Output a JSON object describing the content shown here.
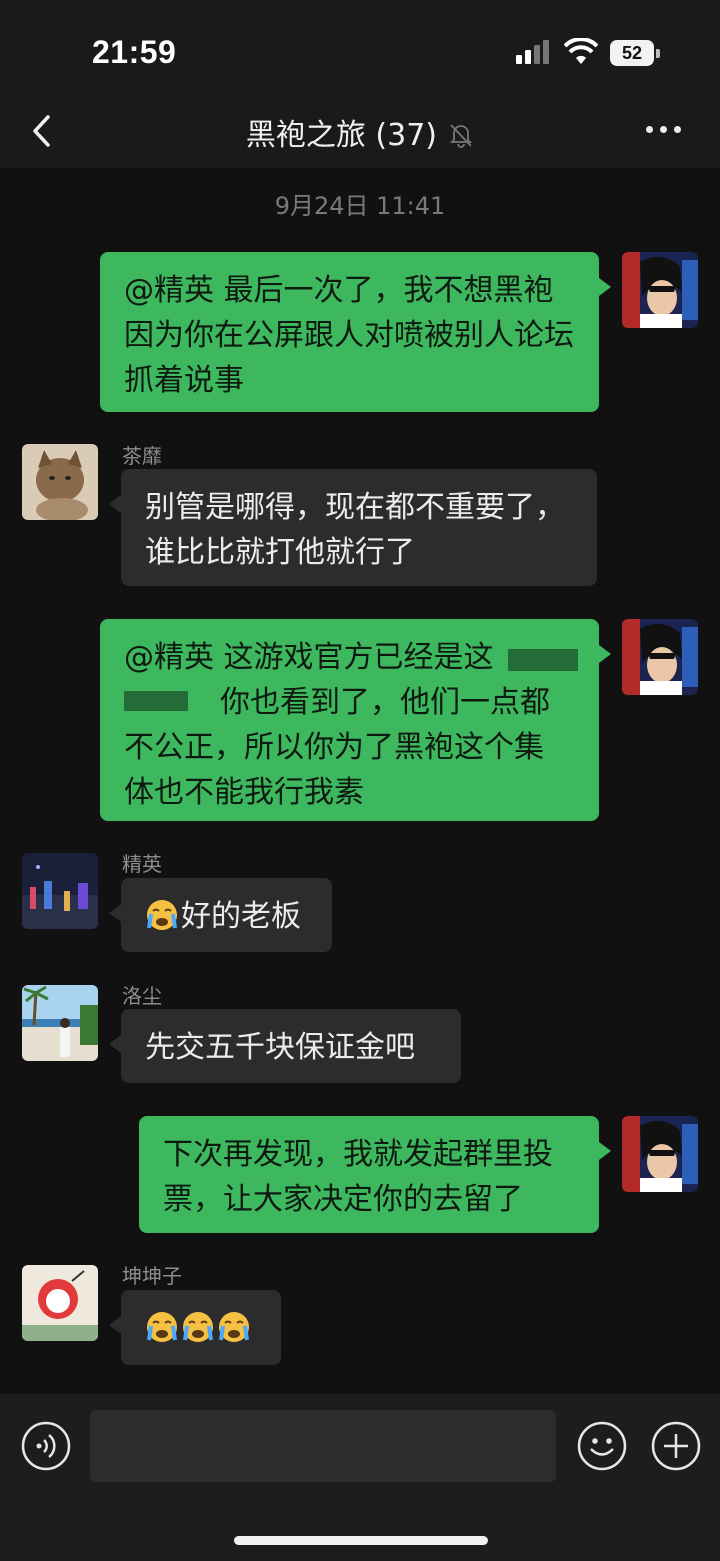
{
  "status_bar": {
    "time": "21:59",
    "battery": "52"
  },
  "header": {
    "title": "黑袍之旅 (37)"
  },
  "chat": {
    "timestamp": "9月24日 11:41",
    "messages": [
      {
        "side": "me",
        "text": "@精英 最后一次了，我不想黑袍因为你在公屏跟人对喷被别人论坛抓着说事"
      },
      {
        "side": "other",
        "sender": "茶靡",
        "text": "别管是哪得，现在都不重要了，谁比比就打他就行了"
      },
      {
        "side": "me",
        "text_line1": "@精英 这游戏官方已经是这",
        "text_line2": "你也看到了，他们一点都",
        "text_line3": "不公正，所以你为了黑袍这个集",
        "text_line4": "体也不能我行我素"
      },
      {
        "side": "other",
        "sender": "精英",
        "emoji": "sob-emoji",
        "text": "好的老板"
      },
      {
        "side": "other",
        "sender": "洛尘",
        "text": "先交五千块保证金吧"
      },
      {
        "side": "me",
        "text": "下次再发现，我就发起群里投票，让大家决定你的去留了"
      },
      {
        "side": "other",
        "sender": "坤坤子",
        "emoji": "sob-emoji",
        "emoji_count": 3
      }
    ]
  },
  "input_bar": {
    "placeholder": ""
  },
  "colors": {
    "my_bubble": "#3eb85f",
    "other_bubble": "#2c2c2c",
    "background": "#111111"
  }
}
